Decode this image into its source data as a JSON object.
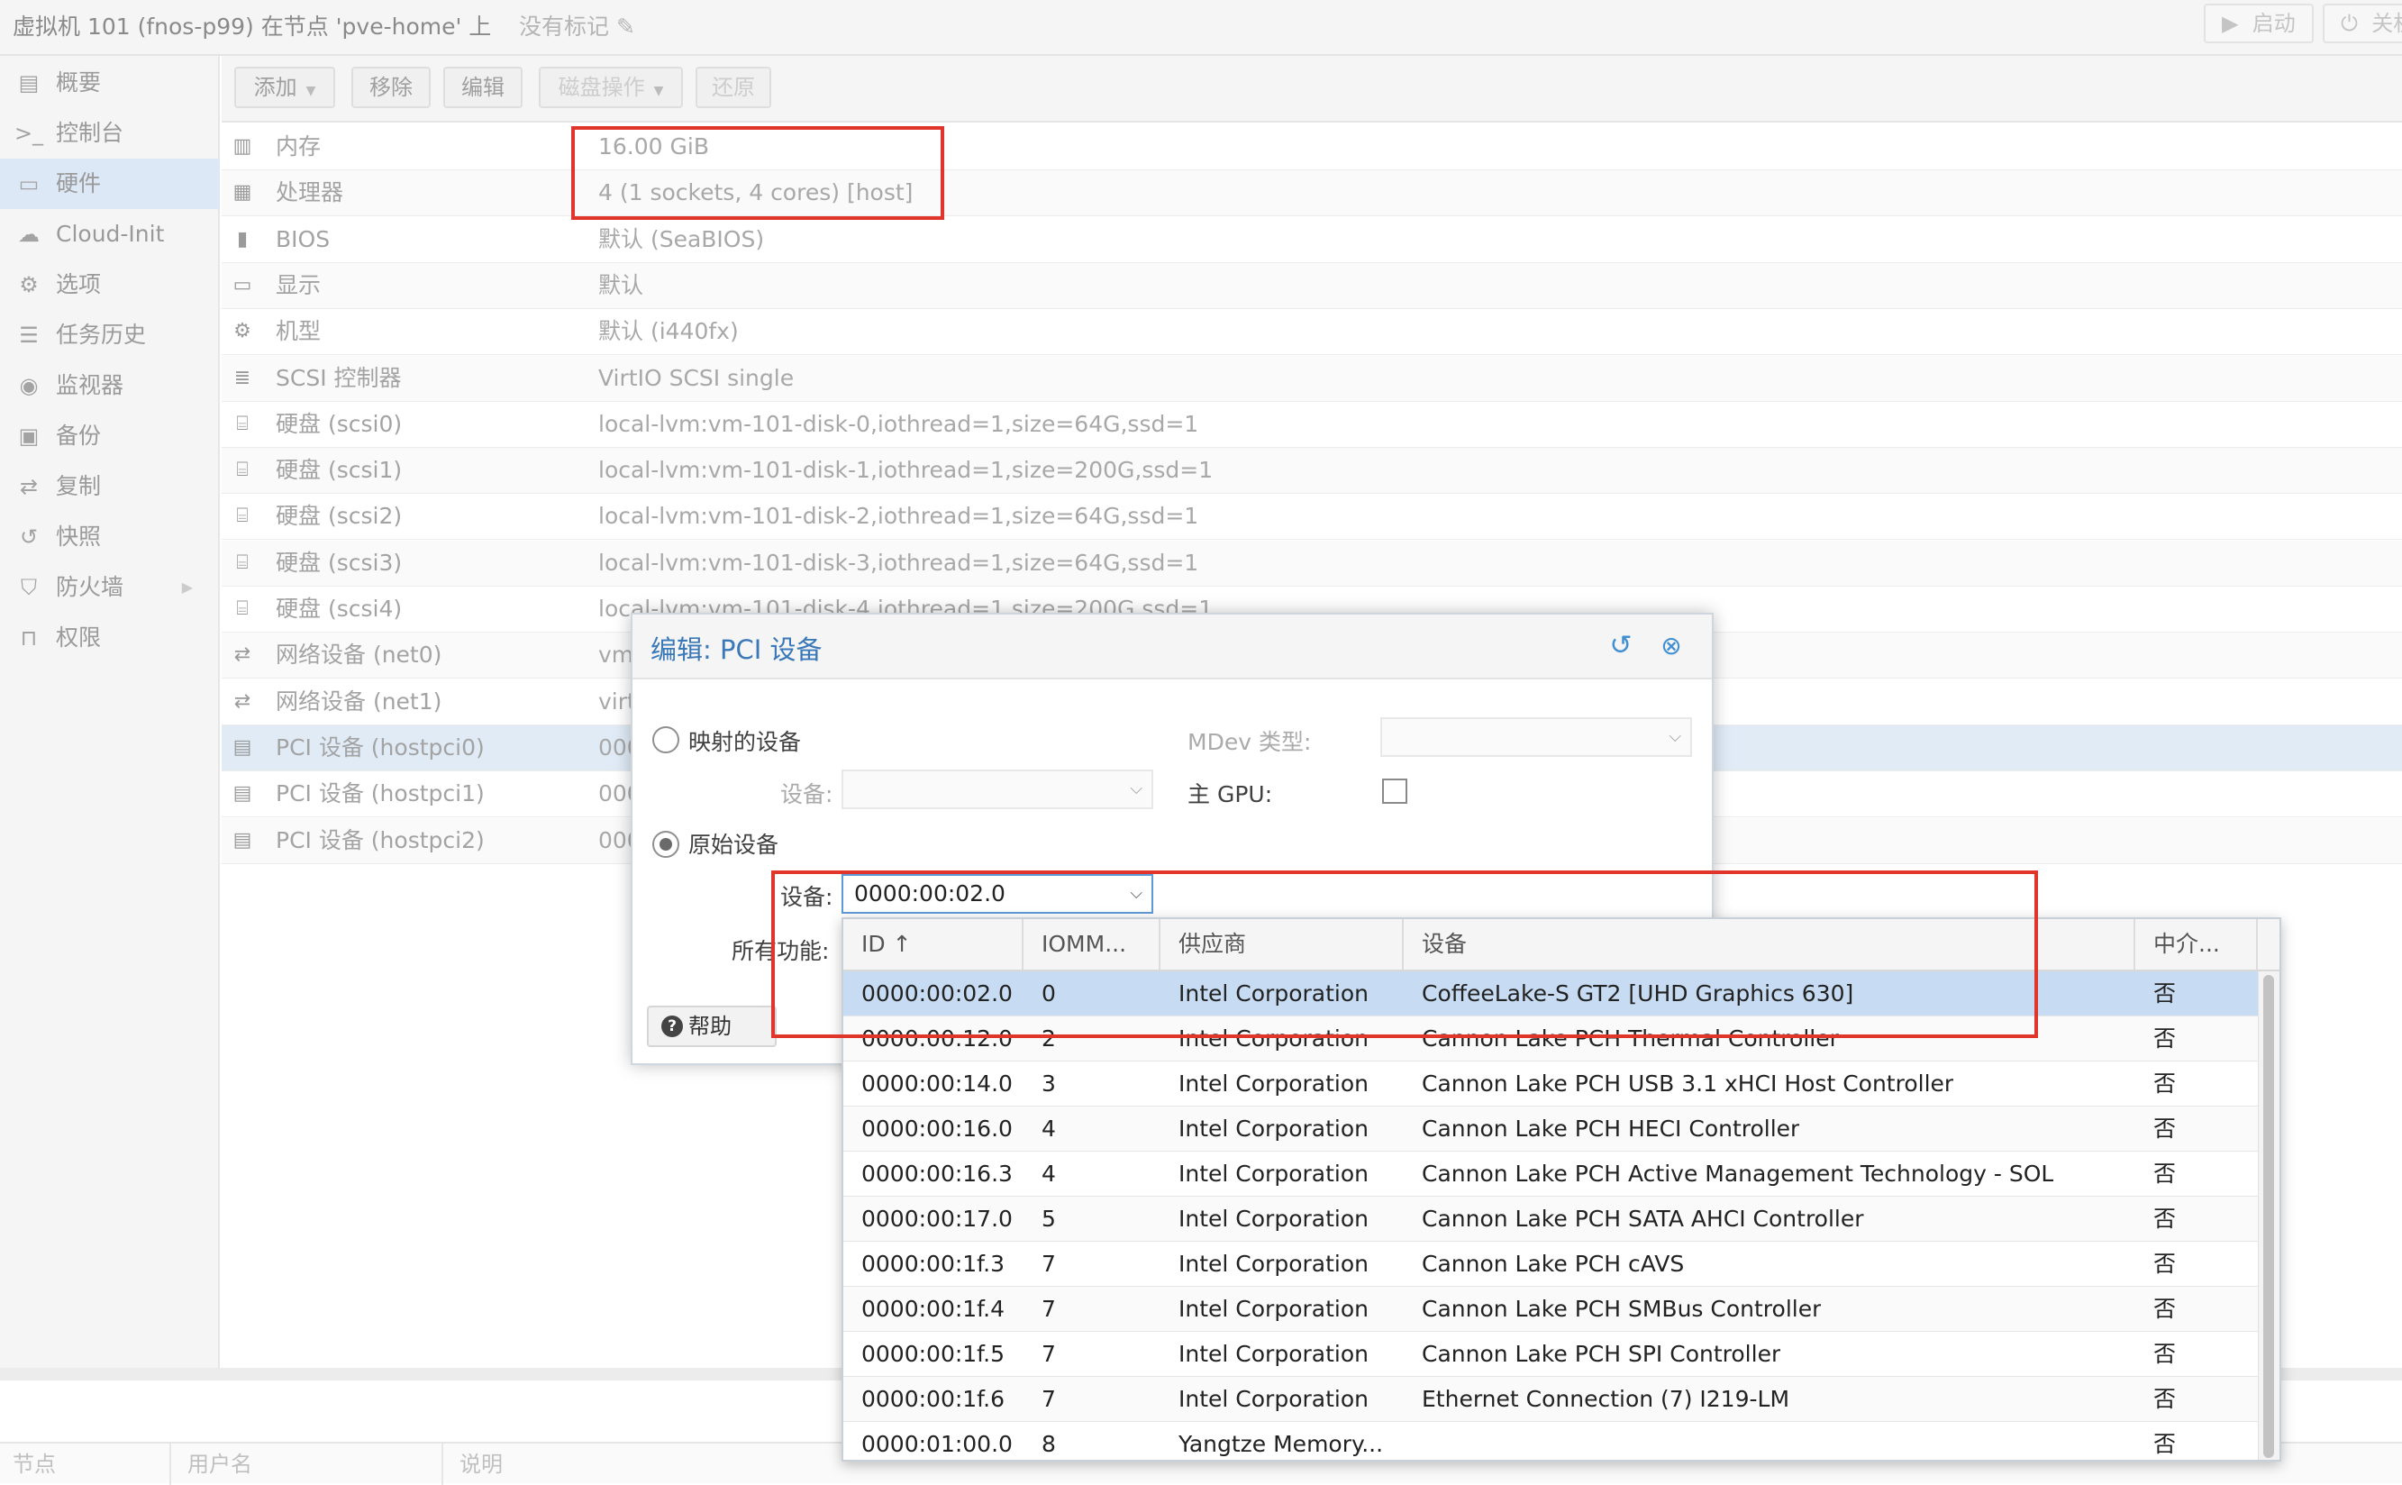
{
  "titlebar": {
    "title": "虚拟机 101 (fnos-p99) 在节点 'pve-home' 上",
    "tags": "没有标记",
    "start_label": "启动",
    "shutdown_label": "关机"
  },
  "sidebar": {
    "items": [
      {
        "label": "概要",
        "icon": "summary-icon"
      },
      {
        "label": "控制台",
        "icon": "console-icon"
      },
      {
        "label": "硬件",
        "icon": "monitor-icon",
        "selected": true
      },
      {
        "label": "Cloud-Init",
        "icon": "cloud-icon"
      },
      {
        "label": "选项",
        "icon": "gear-icon"
      },
      {
        "label": "任务历史",
        "icon": "list-icon"
      },
      {
        "label": "监视器",
        "icon": "eye-icon"
      },
      {
        "label": "备份",
        "icon": "floppy-icon"
      },
      {
        "label": "复制",
        "icon": "retweet-icon"
      },
      {
        "label": "快照",
        "icon": "history-icon"
      },
      {
        "label": "防火墙",
        "icon": "shield-icon"
      },
      {
        "label": "权限",
        "icon": "unlock-icon"
      }
    ]
  },
  "toolbar": {
    "add": "添加",
    "remove": "移除",
    "edit": "编辑",
    "disk_action": "磁盘操作",
    "revert": "还原"
  },
  "hardware": [
    {
      "key": "内存",
      "value": "16.00 GiB",
      "icon": "memory-icon"
    },
    {
      "key": "处理器",
      "value": "4 (1 sockets, 4 cores) [host]",
      "icon": "cpu-icon"
    },
    {
      "key": "BIOS",
      "value": "默认 (SeaBIOS)",
      "icon": "microchip-icon"
    },
    {
      "key": "显示",
      "value": "默认",
      "icon": "desktop-icon"
    },
    {
      "key": "机型",
      "value": "默认 (i440fx)",
      "icon": "cogs-icon"
    },
    {
      "key": "SCSI 控制器",
      "value": "VirtIO SCSI single",
      "icon": "database-icon"
    },
    {
      "key": "硬盘 (scsi0)",
      "value": "local-lvm:vm-101-disk-0,iothread=1,size=64G,ssd=1",
      "icon": "hdd-icon"
    },
    {
      "key": "硬盘 (scsi1)",
      "value": "local-lvm:vm-101-disk-1,iothread=1,size=200G,ssd=1",
      "icon": "hdd-icon"
    },
    {
      "key": "硬盘 (scsi2)",
      "value": "local-lvm:vm-101-disk-2,iothread=1,size=64G,ssd=1",
      "icon": "hdd-icon"
    },
    {
      "key": "硬盘 (scsi3)",
      "value": "local-lvm:vm-101-disk-3,iothread=1,size=64G,ssd=1",
      "icon": "hdd-icon"
    },
    {
      "key": "硬盘 (scsi4)",
      "value": "local-lvm:vm-101-disk-4,iothread=1,size=200G,ssd=1",
      "icon": "hdd-icon"
    },
    {
      "key": "网络设备 (net0)",
      "value": "vm",
      "icon": "exchange-icon"
    },
    {
      "key": "网络设备 (net1)",
      "value": "virt",
      "icon": "exchange-icon"
    },
    {
      "key": "PCI 设备 (hostpci0)",
      "value": "000",
      "icon": "pci-card-icon",
      "selected": true
    },
    {
      "key": "PCI 设备 (hostpci1)",
      "value": "000",
      "icon": "pci-card-icon"
    },
    {
      "key": "PCI 设备 (hostpci2)",
      "value": "000",
      "icon": "pci-card-icon"
    }
  ],
  "log_columns": [
    "节点",
    "用户名",
    "说明"
  ],
  "dialog": {
    "title": "编辑: PCI 设备",
    "mapped_label": "映射的设备",
    "mapped_device_label": "设备:",
    "mdev_label": "MDev 类型:",
    "primary_gpu_label": "主 GPU:",
    "raw_label": "原始设备",
    "raw_device_label": "设备:",
    "raw_device_value": "0000:00:02.0",
    "all_functions_label": "所有功能:",
    "help_label": "帮助"
  },
  "picker": {
    "columns": [
      "ID ↑",
      "IOMM...",
      "供应商",
      "设备",
      "中介..."
    ],
    "rows": [
      {
        "id": "0000:00:02.0",
        "iommu": "0",
        "vendor": "Intel Corporation",
        "device": "CoffeeLake-S GT2 [UHD Graphics 630]",
        "mdev": "否",
        "selected": true
      },
      {
        "id": "0000:00:12.0",
        "iommu": "2",
        "vendor": "Intel Corporation",
        "device": "Cannon Lake PCH Thermal Controller",
        "mdev": "否"
      },
      {
        "id": "0000:00:14.0",
        "iommu": "3",
        "vendor": "Intel Corporation",
        "device": "Cannon Lake PCH USB 3.1 xHCI Host Controller",
        "mdev": "否"
      },
      {
        "id": "0000:00:16.0",
        "iommu": "4",
        "vendor": "Intel Corporation",
        "device": "Cannon Lake PCH HECI Controller",
        "mdev": "否"
      },
      {
        "id": "0000:00:16.3",
        "iommu": "4",
        "vendor": "Intel Corporation",
        "device": "Cannon Lake PCH Active Management Technology - SOL",
        "mdev": "否"
      },
      {
        "id": "0000:00:17.0",
        "iommu": "5",
        "vendor": "Intel Corporation",
        "device": "Cannon Lake PCH SATA AHCI Controller",
        "mdev": "否"
      },
      {
        "id": "0000:00:1f.3",
        "iommu": "7",
        "vendor": "Intel Corporation",
        "device": "Cannon Lake PCH cAVS",
        "mdev": "否"
      },
      {
        "id": "0000:00:1f.4",
        "iommu": "7",
        "vendor": "Intel Corporation",
        "device": "Cannon Lake PCH SMBus Controller",
        "mdev": "否"
      },
      {
        "id": "0000:00:1f.5",
        "iommu": "7",
        "vendor": "Intel Corporation",
        "device": "Cannon Lake PCH SPI Controller",
        "mdev": "否"
      },
      {
        "id": "0000:00:1f.6",
        "iommu": "7",
        "vendor": "Intel Corporation",
        "device": "Ethernet Connection (7) I219-LM",
        "mdev": "否"
      },
      {
        "id": "0000:01:00.0",
        "iommu": "8",
        "vendor": "Yangtze Memory...",
        "device": "",
        "mdev": "否"
      }
    ]
  },
  "colors": {
    "highlight": "#e0352b",
    "accent": "#3a78b8",
    "selected_row": "#c7dcf2"
  }
}
